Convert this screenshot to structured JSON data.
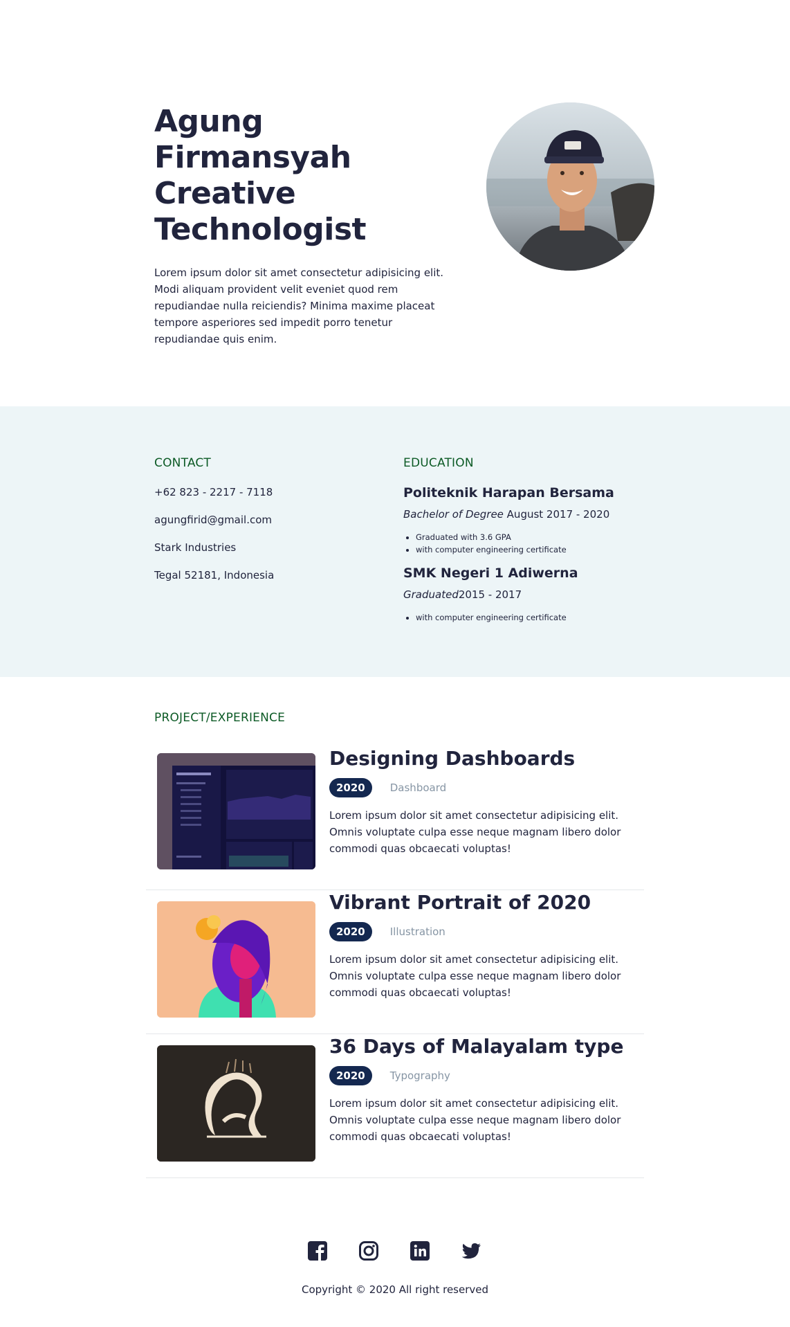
{
  "hero": {
    "title_line1": "Agung Firmansyah",
    "title_line2": "Creative",
    "title_line3": "Technologist",
    "bio": "Lorem ipsum dolor sit amet consectetur adipisicing elit. Modi aliquam provident velit eveniet quod rem repudiandae nulla reiciendis? Minima maxime placeat tempore asperiores sed impedit porro tenetur repudiandae quis enim."
  },
  "contact": {
    "heading": "CONTACT",
    "phone": "+62 823 - 2217 - 7118",
    "email": "agungfirid@gmail.com",
    "company": "Stark Industries",
    "address": "Tegal 52181, Indonesia"
  },
  "education": {
    "heading": "EDUCATION",
    "schools": [
      {
        "name": "Politeknik Harapan Bersama",
        "degree": "Bachelor of Degree",
        "years": " August 2017 - 2020",
        "notes": [
          "Graduated with 3.6 GPA",
          "with computer engineering certificate"
        ]
      },
      {
        "name": "SMK Negeri 1 Adiwerna",
        "degree": "Graduated",
        "years": "2015 - 2017",
        "notes": [
          "with computer engineering certificate"
        ]
      }
    ]
  },
  "projects": {
    "heading": "PROJECT/EXPERIENCE",
    "items": [
      {
        "title": "Designing Dashboards",
        "year": "2020",
        "category": "Dashboard",
        "description": "Lorem ipsum dolor sit amet consectetur adipisicing elit. Omnis voluptate culpa esse neque magnam libero dolor commodi quas obcaecati voluptas!"
      },
      {
        "title": "Vibrant Portrait of 2020",
        "year": "2020",
        "category": "Illustration",
        "description": "Lorem ipsum dolor sit amet consectetur adipisicing elit. Omnis voluptate culpa esse neque magnam libero dolor commodi quas obcaecati voluptas!"
      },
      {
        "title": "36 Days of Malayalam type",
        "year": "2020",
        "category": "Typography",
        "description": "Lorem ipsum dolor sit amet consectetur adipisicing elit. Omnis voluptate culpa esse neque magnam libero dolor commodi quas obcaecati voluptas!"
      }
    ]
  },
  "footer": {
    "socials": [
      "facebook-icon",
      "instagram-icon",
      "linkedin-icon",
      "twitter-icon"
    ],
    "copyright": "Copyright © 2020 All right reserved"
  },
  "colors": {
    "text": "#21243d",
    "accent_green": "#0c5a25",
    "badge": "#142850",
    "muted": "#8695a4",
    "info_bg": "#edf5f7"
  }
}
